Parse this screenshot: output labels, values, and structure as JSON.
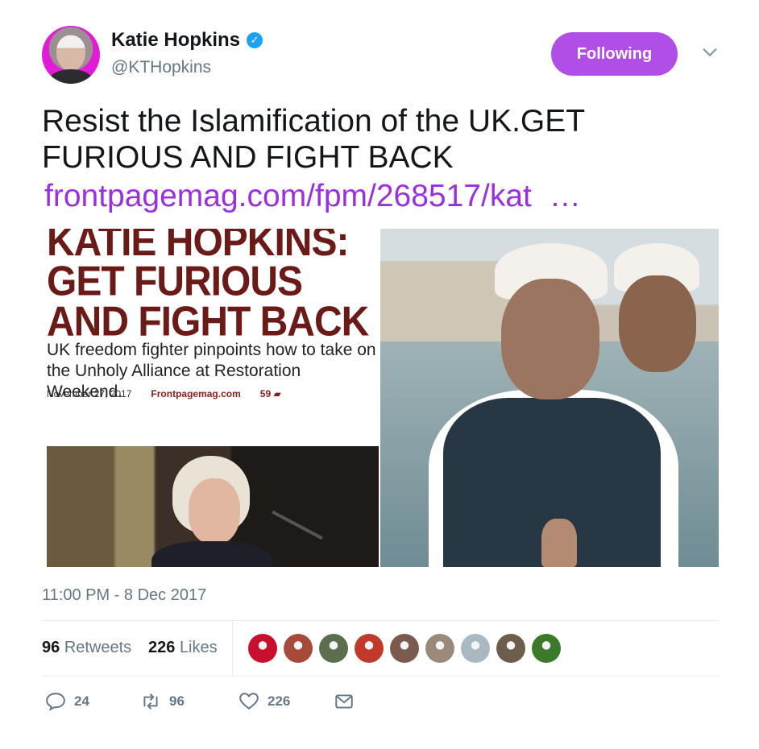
{
  "author": {
    "name": "Katie Hopkins",
    "handle": "@KTHopkins",
    "verified": true,
    "follow_label": "Following"
  },
  "tweet": {
    "text": "Resist the Islamification of the UK.GET FURIOUS AND FIGHT BACK",
    "link": "frontpagemag.com/fpm/268517/kat",
    "link_ellipsis": "…",
    "timestamp": "11:00 PM - 8 Dec 2017"
  },
  "media": {
    "article_headline": "KATIE HOPKINS: GET FURIOUS AND FIGHT BACK",
    "article_subtitle": "UK freedom fighter pinpoints how to take on the Unholy Alliance at Restoration Weekend.",
    "article_date": "November 27, 2017",
    "article_source": "Frontpagemag.com",
    "article_comments": "59"
  },
  "stats": {
    "retweets_count": "96",
    "retweets_label": "Retweets",
    "likes_count": "226",
    "likes_label": "Likes"
  },
  "likers": [
    "#c8102e",
    "#a84a3a",
    "#5b6e4d",
    "#c0392b",
    "#7a5b4e",
    "#9b8a7a",
    "#aab8c2",
    "#6d5d4b",
    "#3b7a2a"
  ],
  "actions": {
    "reply_count": "24",
    "retweet_count": "96",
    "like_count": "226"
  },
  "colors": {
    "accent": "#b14ee8",
    "link": "#9b30e0",
    "muted": "#657786",
    "verified": "#1da1f2"
  }
}
